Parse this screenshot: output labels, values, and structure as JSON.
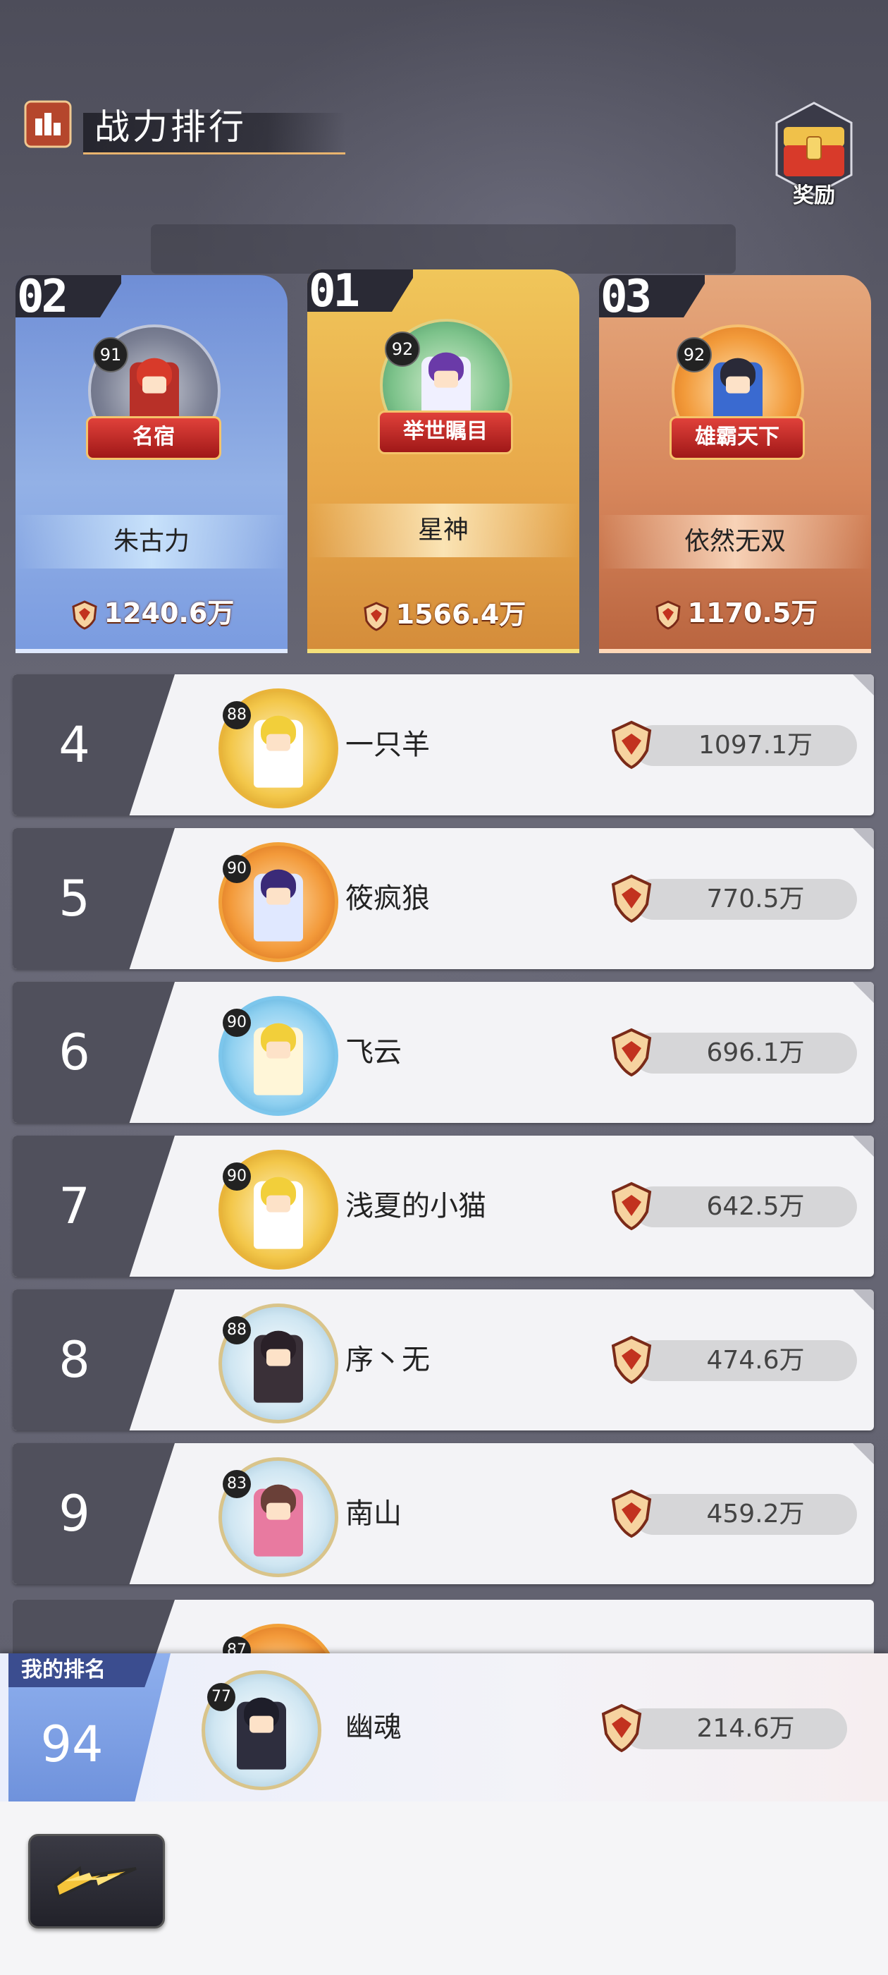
{
  "header": {
    "title": "战力排行",
    "reward_label": "奖励"
  },
  "podium": [
    {
      "rank": "02",
      "level": "91",
      "title_badge": "名宿",
      "name": "朱古力",
      "power": "1240.6万"
    },
    {
      "rank": "01",
      "level": "92",
      "title_badge": "举世瞩目",
      "name": "星神",
      "power": "1566.4万"
    },
    {
      "rank": "03",
      "level": "92",
      "title_badge": "雄霸天下",
      "name": "依然无双",
      "power": "1170.5万"
    }
  ],
  "rows": [
    {
      "rank": "4",
      "level": "88",
      "name": "一只羊",
      "power": "1097.1万"
    },
    {
      "rank": "5",
      "level": "90",
      "name": "筱疯狼",
      "power": "770.5万"
    },
    {
      "rank": "6",
      "level": "90",
      "name": "飞云",
      "power": "696.1万"
    },
    {
      "rank": "7",
      "level": "90",
      "name": "浅夏的小猫",
      "power": "642.5万"
    },
    {
      "rank": "8",
      "level": "88",
      "name": "序丶无",
      "power": "474.6万"
    },
    {
      "rank": "9",
      "level": "83",
      "name": "南山",
      "power": "459.2万"
    }
  ],
  "partial_row": {
    "level": "87"
  },
  "my_rank": {
    "tag": "我的排名",
    "rank": "94",
    "level": "77",
    "name": "幽魂",
    "power": "214.6万"
  },
  "icons": {
    "header": "ranking-badge-icon",
    "reward": "treasure-chest-icon",
    "power": "shield-power-icon",
    "back": "lightning-back-icon"
  },
  "colors": {
    "accent_gold": "#e9b46e",
    "rank_box": "#50505c",
    "my_rank_tag": "#3b4d8f"
  }
}
